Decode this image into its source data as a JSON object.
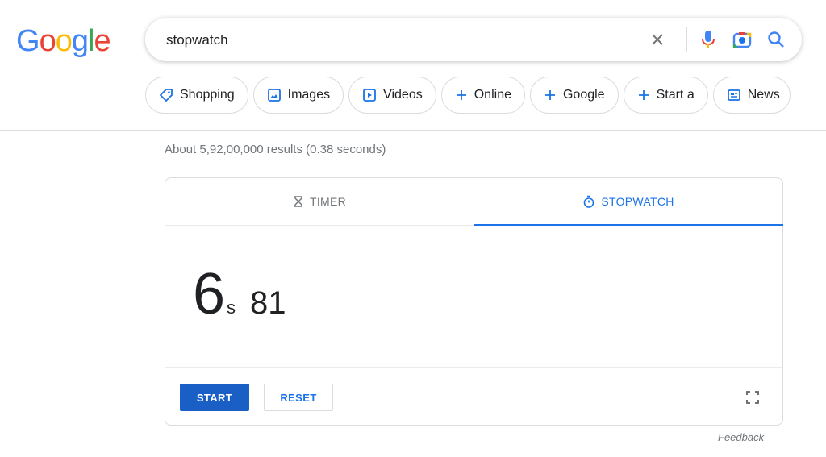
{
  "logo": {
    "letters": [
      "G",
      "o",
      "o",
      "g",
      "l",
      "e"
    ],
    "colors": [
      "#4285F4",
      "#EA4335",
      "#FBBC05",
      "#4285F4",
      "#34A853",
      "#EA4335"
    ]
  },
  "search": {
    "value": "stopwatch",
    "icons": [
      "clear-icon",
      "microphone-icon",
      "camera-icon",
      "search-icon"
    ]
  },
  "chips": [
    {
      "label": "Shopping",
      "icon": "tag-icon"
    },
    {
      "label": "Images",
      "icon": "image-icon"
    },
    {
      "label": "Videos",
      "icon": "play-icon"
    },
    {
      "label": "Online",
      "icon": "plus-icon"
    },
    {
      "label": "Google",
      "icon": "plus-icon"
    },
    {
      "label": "Start a",
      "icon": "plus-icon"
    },
    {
      "label": "News",
      "icon": "news-icon"
    }
  ],
  "results": {
    "stats": "About 5,92,00,000 results (0.38 seconds)"
  },
  "widget": {
    "tabs": [
      {
        "label": "TIMER",
        "icon": "hourglass-icon"
      },
      {
        "label": "STOPWATCH",
        "icon": "stopwatch-icon",
        "active": true
      }
    ],
    "time": {
      "seconds": "6",
      "unit": "s",
      "centis": "81"
    },
    "start_label": "START",
    "reset_label": "RESET",
    "fullscreen_icon": "fullscreen-icon"
  },
  "feedback": "Feedback",
  "colors": {
    "accent": "#1a73e8",
    "start_button": "#1a5fc6",
    "mic_blue": "#4285F4"
  }
}
